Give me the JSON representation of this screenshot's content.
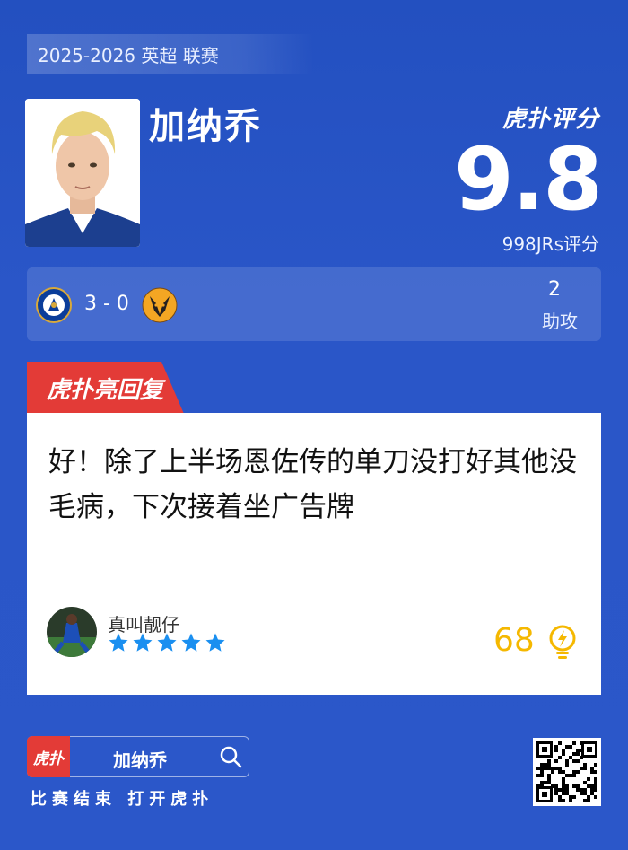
{
  "header": {
    "season": "2025-2026 英超 联赛"
  },
  "player": {
    "name": "加纳乔"
  },
  "rating": {
    "brand": "虎扑评分",
    "score": "9.8",
    "votes": "998JRs评分"
  },
  "match": {
    "score": "3 - 0",
    "home_team": "Chelsea",
    "away_team": "Wolves",
    "stat_value": "2",
    "stat_label": "助攻"
  },
  "reply": {
    "tab_label": "虎扑亮回复",
    "text": "好！除了上半场恩佐传的单刀没打好其他没毛病，下次接着坐广告牌",
    "username": "真叫靓仔",
    "stars": 5,
    "likes": "68"
  },
  "footer": {
    "app_icon_label": "虎扑",
    "search_text": "加纳乔",
    "cta": "比赛结束 打开虎扑"
  },
  "colors": {
    "background": "#2a56c8",
    "accent_red": "#e33b37",
    "likes_yellow": "#f5b800",
    "star_blue": "#1a8ff0"
  },
  "icons": [
    "chelsea-badge-icon",
    "wolves-badge-icon",
    "star-icon",
    "lightbulb-icon",
    "search-icon",
    "qr-code-icon"
  ]
}
